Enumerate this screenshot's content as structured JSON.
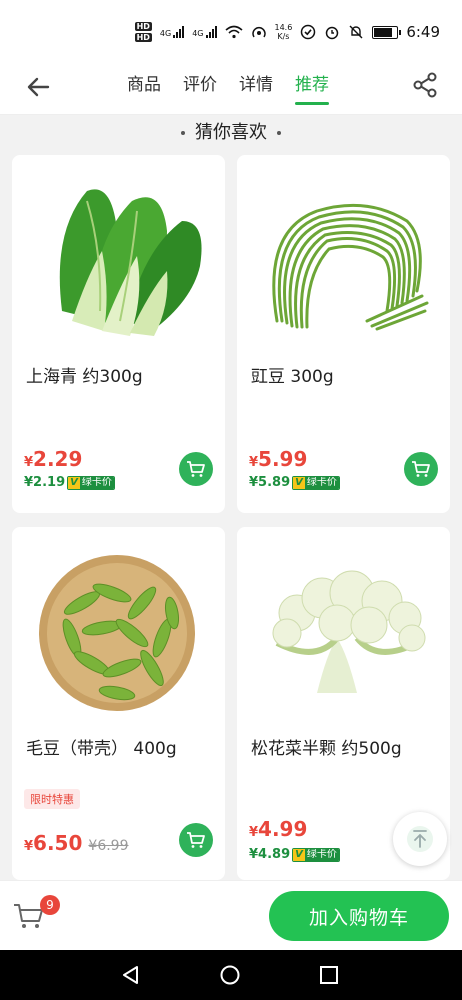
{
  "status_bar": {
    "network_rate": "14.6",
    "network_unit": "K/s",
    "hd1": "HD",
    "hd2": "HD",
    "signal1": "4G",
    "signal2": "4G",
    "time": "6:49"
  },
  "nav": {
    "tabs": [
      {
        "label": "商品"
      },
      {
        "label": "评价"
      },
      {
        "label": "详情"
      },
      {
        "label": "推荐"
      }
    ],
    "active_tab": "推荐"
  },
  "section": {
    "title": "猜你喜欢"
  },
  "products": [
    {
      "name": "上海青 约300g",
      "currency": "¥",
      "price": "2.29",
      "vip_price": "¥2.19",
      "vip_label": "绿卡价"
    },
    {
      "name": "豇豆 300g",
      "currency": "¥",
      "price": "5.99",
      "vip_price": "¥5.89",
      "vip_label": "绿卡价"
    },
    {
      "name": "毛豆（带壳） 400g",
      "promo": "限时特惠",
      "currency": "¥",
      "price": "6.50",
      "original_price": "¥6.99"
    },
    {
      "name": "松花菜半颗 约500g",
      "currency": "¥",
      "price": "4.99",
      "vip_price": "¥4.89",
      "vip_label": "绿卡价"
    }
  ],
  "vip_badge_letter": "V",
  "bottom_bar": {
    "cart_count": "9",
    "add_to_cart": "加入购物车"
  },
  "colors": {
    "accent": "#23b14d",
    "price": "#e8463b",
    "vip": "#1d8f3f"
  }
}
